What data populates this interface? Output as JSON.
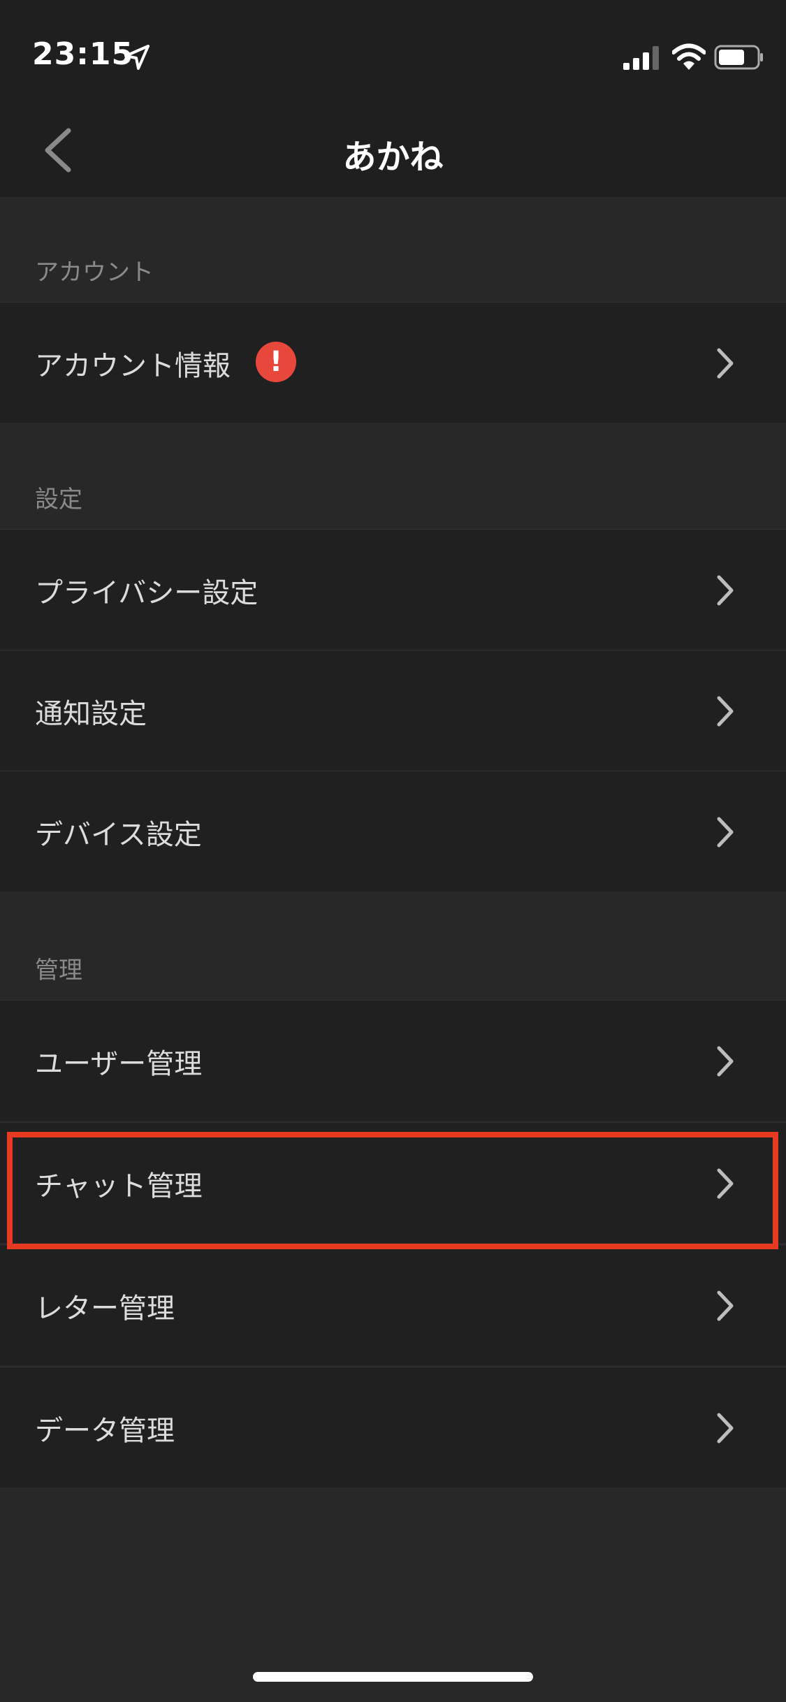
{
  "status_bar": {
    "time": "23:15",
    "icons": [
      "location-arrow-icon",
      "signal-icon",
      "wifi-icon",
      "battery-icon"
    ]
  },
  "nav": {
    "title": "あかね",
    "back_icon": "chevron-left-icon"
  },
  "sections": {
    "account": {
      "header": "アカウント",
      "items": [
        {
          "label": "アカウント情報",
          "badge": "!"
        }
      ]
    },
    "settings": {
      "header": "設定",
      "items": [
        {
          "label": "プライバシー設定"
        },
        {
          "label": "通知設定"
        },
        {
          "label": "デバイス設定"
        }
      ]
    },
    "management": {
      "header": "管理",
      "items": [
        {
          "label": "ユーザー管理"
        },
        {
          "label": "チャット管理"
        },
        {
          "label": "レター管理"
        },
        {
          "label": "データ管理"
        }
      ]
    }
  },
  "colors": {
    "background": "#282828",
    "row_background": "#202020",
    "alert": "#e8483c",
    "highlight": "#e83a22"
  }
}
